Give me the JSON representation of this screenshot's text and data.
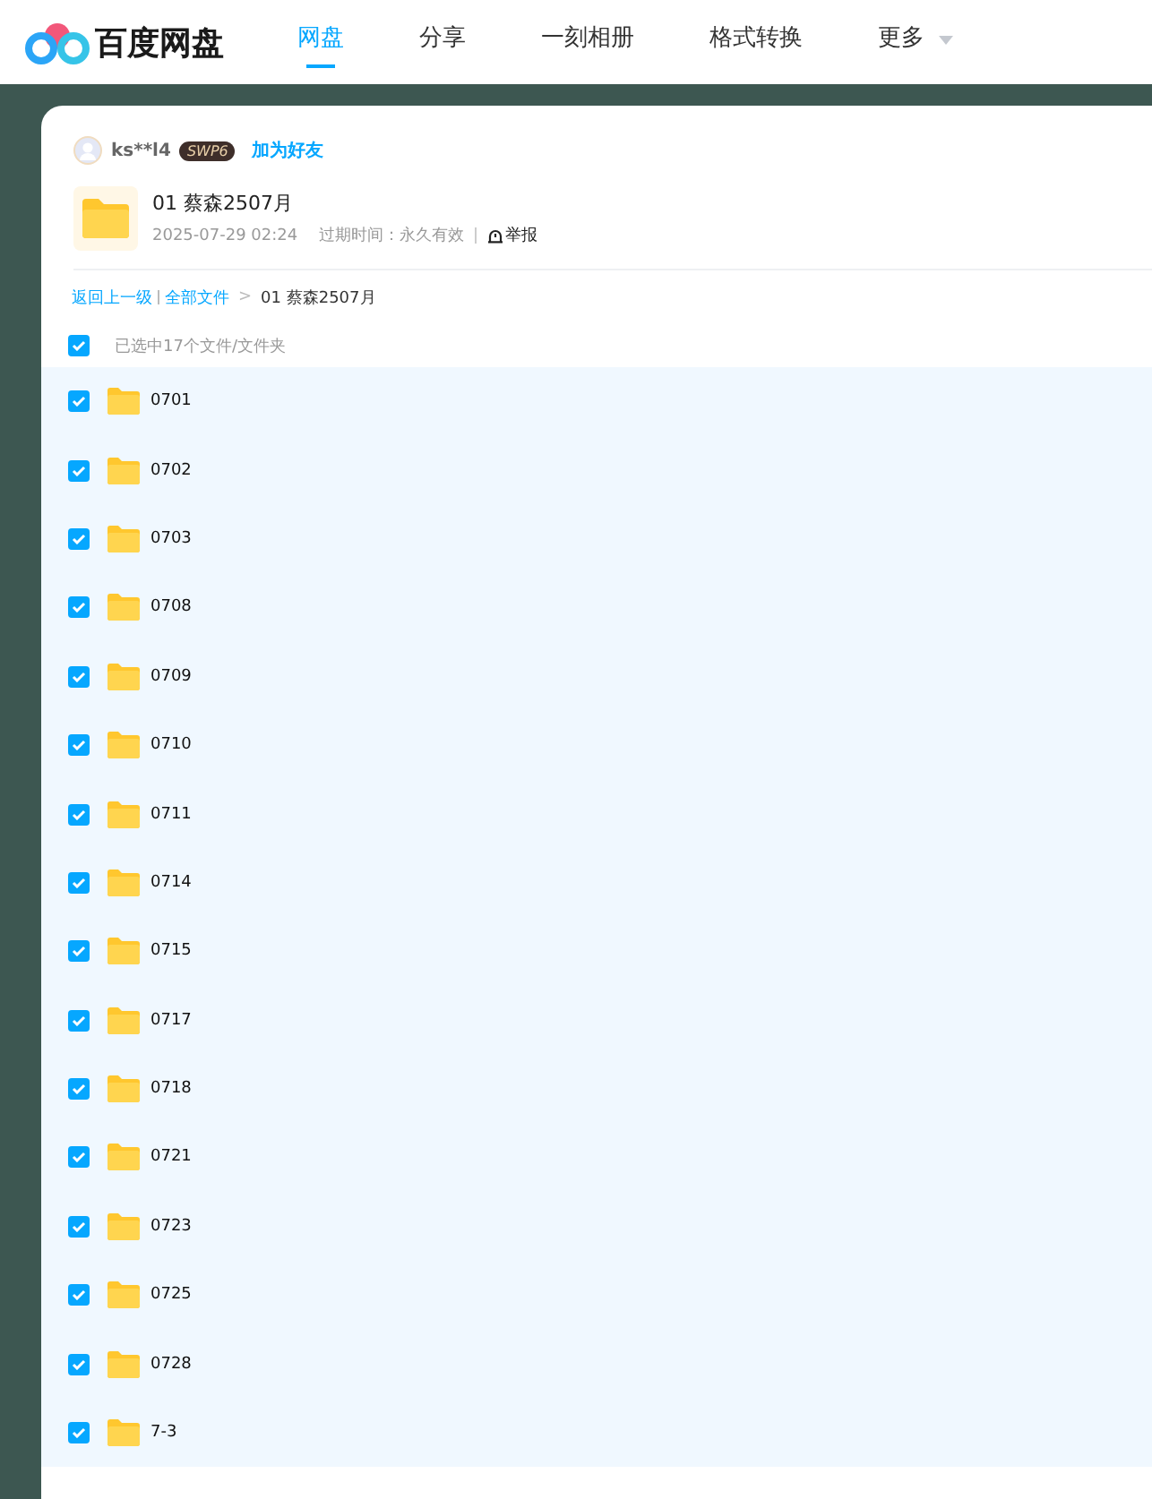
{
  "header": {
    "logo_text": "百度网盘",
    "tabs": [
      {
        "label": "网盘",
        "selected": true
      },
      {
        "label": "分享",
        "selected": false
      },
      {
        "label": "一刻相册",
        "selected": false
      },
      {
        "label": "格式转换",
        "selected": false
      },
      {
        "label": "更多",
        "selected": false,
        "dropdown": true
      }
    ]
  },
  "sharer": {
    "name": "ks**l4",
    "badge": "SWP6",
    "add_friend": "加为好友"
  },
  "share": {
    "title": "01 蔡森2507月",
    "date": "2025-07-29 02:24",
    "expiry": "过期时间：永久有效",
    "report": "举报"
  },
  "breadcrumb": {
    "back": "返回上一级",
    "all": "全部文件",
    "separator": ">",
    "current": "01 蔡森2507月"
  },
  "select_all": {
    "checked": true,
    "label": "已选中17个文件/文件夹"
  },
  "files": [
    {
      "name": "0701",
      "checked": true
    },
    {
      "name": "0702",
      "checked": true
    },
    {
      "name": "0703",
      "checked": true
    },
    {
      "name": "0708",
      "checked": true
    },
    {
      "name": "0709",
      "checked": true
    },
    {
      "name": "0710",
      "checked": true
    },
    {
      "name": "0711",
      "checked": true
    },
    {
      "name": "0714",
      "checked": true
    },
    {
      "name": "0715",
      "checked": true
    },
    {
      "name": "0717",
      "checked": true
    },
    {
      "name": "0718",
      "checked": true
    },
    {
      "name": "0721",
      "checked": true
    },
    {
      "name": "0723",
      "checked": true
    },
    {
      "name": "0725",
      "checked": true
    },
    {
      "name": "0728",
      "checked": true
    },
    {
      "name": "7-3",
      "checked": true
    }
  ]
}
